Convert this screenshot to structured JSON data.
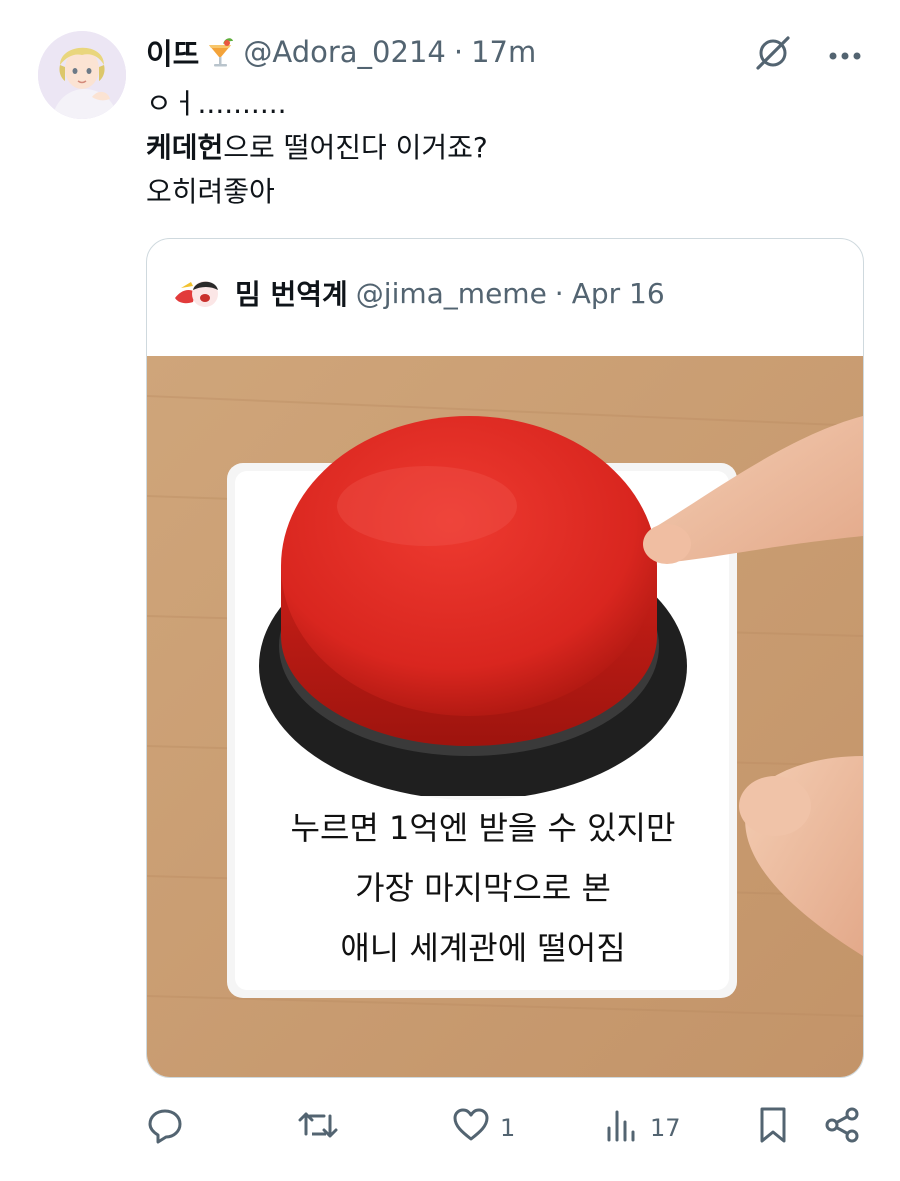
{
  "tweet": {
    "author_name": "이뜨",
    "handle": "@Adora_0214",
    "separator": "·",
    "time": "17m",
    "lines": [
      "ㅇㅓ..........",
      "케데헌",
      "으로 떨어진다 이거죠?",
      "오히려좋아"
    ]
  },
  "quote": {
    "author_name": "밈 번역계",
    "handle": "@jima_meme",
    "separator": "·",
    "date": "Apr 16",
    "image_caption": [
      "누르면 1억엔 받을 수 있지만",
      "가장 마지막으로 본",
      "애니 세계관에 떨어짐"
    ]
  },
  "actions": {
    "reply_count": "",
    "retweet_count": "",
    "like_count": "1",
    "views_count": "17"
  },
  "colors": {
    "text_primary": "#0f1419",
    "text_secondary": "#536471",
    "border": "#cfd9de",
    "button_red": "#d9261f"
  },
  "icons": {
    "header": [
      "grok-icon",
      "more-icon"
    ],
    "actions": [
      "reply-icon",
      "retweet-icon",
      "like-icon",
      "views-icon",
      "bookmark-icon",
      "share-icon"
    ]
  }
}
